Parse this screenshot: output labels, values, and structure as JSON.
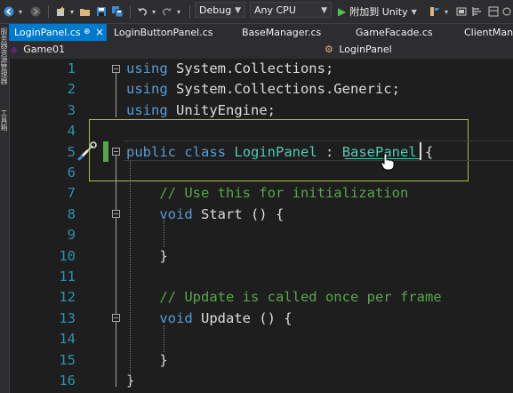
{
  "toolbar": {
    "config_value": "Debug",
    "platform_value": "Any CPU",
    "attach_label": "附加到 Unity",
    "icons": [
      "back-icon",
      "forward-icon",
      "new-project-icon",
      "open-file-icon",
      "save-icon",
      "save-all-icon",
      "undo-icon",
      "redo-icon",
      "play-icon",
      "scheduler-icon"
    ]
  },
  "sidebar": {
    "top_label": "服务器资源管理器",
    "bottom_label": "工具箱"
  },
  "tabs": [
    {
      "label": "LoginPanel.cs",
      "pin": "⊕",
      "close": "×",
      "active": true
    },
    {
      "label": "LoginButtonPanel.cs"
    },
    {
      "label": "BaseManager.cs"
    },
    {
      "label": "GameFacade.cs"
    },
    {
      "label": "ClientMana"
    }
  ],
  "navbar": {
    "project": "Game01",
    "member": "LoginPanel"
  },
  "editor": {
    "line_numbers": [
      "1",
      "2",
      "3",
      "4",
      "5",
      "6",
      "7",
      "8",
      "9",
      "10",
      "11",
      "12",
      "13",
      "14",
      "15",
      "16"
    ],
    "lines": [
      [
        {
          "t": "using",
          "c": "kw"
        },
        {
          "t": " System.Collections;"
        }
      ],
      [
        {
          "t": "using",
          "c": "kw"
        },
        {
          "t": " System.Collections.Generic;"
        }
      ],
      [
        {
          "t": "using",
          "c": "kw"
        },
        {
          "t": " UnityEngine;"
        }
      ],
      [],
      [
        {
          "t": "public",
          "c": "kw"
        },
        {
          "t": " "
        },
        {
          "t": "class",
          "c": "kw"
        },
        {
          "t": " "
        },
        {
          "t": "LoginPanel",
          "c": "ty"
        },
        {
          "t": " : "
        },
        {
          "t": "BasePanel",
          "c": "ty"
        },
        {
          "t": " {"
        }
      ],
      [],
      [
        {
          "t": "    // Use this for initialization",
          "c": "cm"
        }
      ],
      [
        {
          "t": "    "
        },
        {
          "t": "void",
          "c": "kw"
        },
        {
          "t": " Start () {"
        }
      ],
      [],
      [
        {
          "t": "    }"
        }
      ],
      [],
      [
        {
          "t": "    // Update is called once per frame",
          "c": "cm"
        }
      ],
      [
        {
          "t": "    "
        },
        {
          "t": "void",
          "c": "kw"
        },
        {
          "t": " Update () {"
        }
      ],
      [],
      [
        {
          "t": "    }"
        }
      ],
      [
        {
          "t": "}"
        }
      ]
    ],
    "colors": {
      "keyword": "#569cd6",
      "type": "#4ec9b0",
      "comment": "#57a64a",
      "line_number": "#2b91af",
      "text": "#dcdcdc",
      "background": "#1e1e1e",
      "highlight_border": "#b2bd3c",
      "active_tab": "#007acc"
    },
    "lightbulb_icon": "screwdriver-brush-icon",
    "cursor_icon": "hand-pointer-icon"
  }
}
